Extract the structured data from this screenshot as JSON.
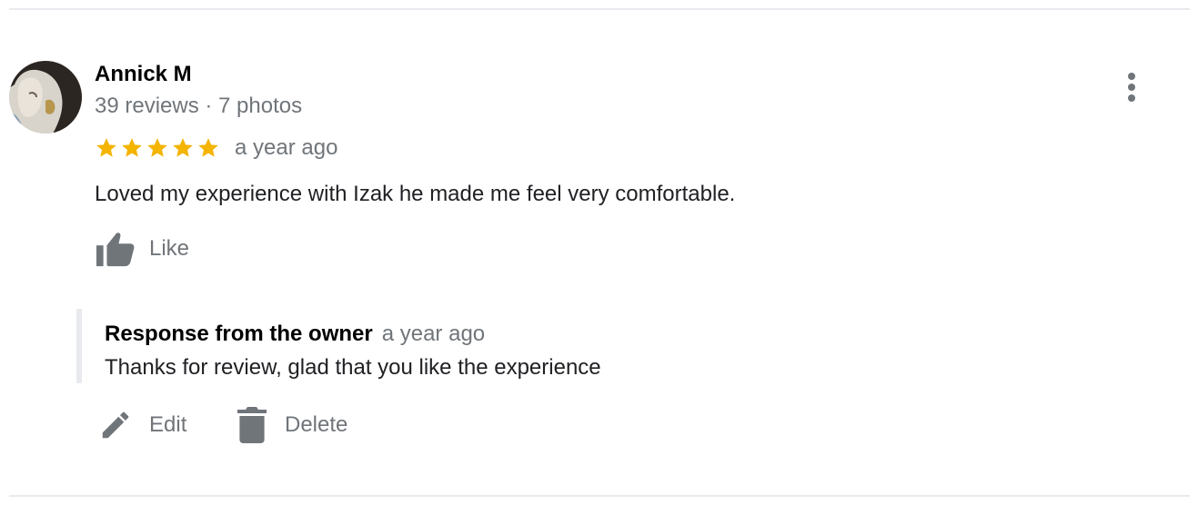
{
  "review": {
    "reviewer_name": "Annick M",
    "reviewer_meta": "39 reviews · 7 photos",
    "rating": 5,
    "rating_max": 5,
    "date": "a year ago",
    "text": "Loved my experience with Izak he made me feel very comfortable.",
    "like_label": "Like"
  },
  "owner_response": {
    "title": "Response from the owner",
    "date": "a year ago",
    "text": "Thanks for review, glad that you like the experience"
  },
  "actions": {
    "edit_label": "Edit",
    "delete_label": "Delete"
  },
  "icons": {
    "more": "more-vert-icon",
    "star": "star-icon",
    "like": "thumb-up-icon",
    "edit": "pencil-icon",
    "delete": "trash-icon"
  },
  "colors": {
    "star": "#f4b400",
    "secondary_text": "#70757a",
    "primary_text": "#202124",
    "divider": "#e8eaed"
  }
}
